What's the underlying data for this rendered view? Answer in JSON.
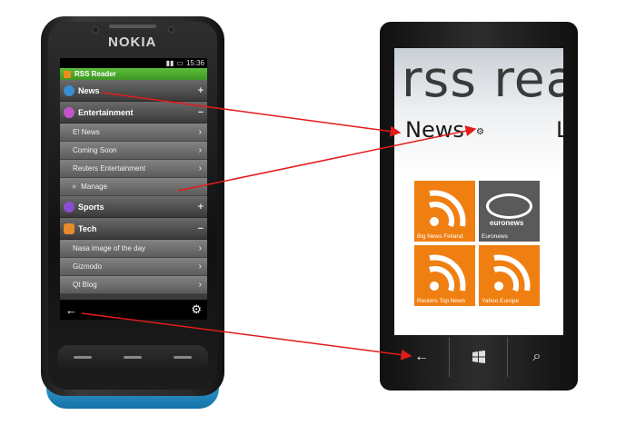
{
  "nokia": {
    "brand": "NOKIA",
    "status_time": "15:36",
    "app_title": "RSS Reader",
    "categories": [
      {
        "label": "News",
        "sign": "+",
        "color": "#3b8fd0"
      },
      {
        "label": "Entertainment",
        "sign": "−",
        "color": "#c455c8",
        "items": [
          "E! News",
          "Coming Soon",
          "Reuters Entertainment"
        ],
        "manage": "Manage"
      },
      {
        "label": "Sports",
        "sign": "+",
        "color": "#8a4fd0"
      },
      {
        "label": "Tech",
        "sign": "−",
        "color": "#e88a2b",
        "items": [
          "Nasa image of the day",
          "Gizmodo",
          "Qt Blog"
        ]
      }
    ]
  },
  "wp": {
    "heading": "rss rea",
    "pivot": "News",
    "pivot_next": "L",
    "tiles": [
      {
        "label": "Big News Finland",
        "color": "#f07f12",
        "icon": "rss-icon"
      },
      {
        "label": "Euronews",
        "color": "#5a5a5a",
        "icon": "euronews-logo",
        "logo_text": "euronews"
      },
      {
        "label": "Reuters Top News",
        "color": "#f07f12",
        "icon": "rss-icon"
      },
      {
        "label": "Yahoo Europe",
        "color": "#f07f12",
        "icon": "rss-icon"
      }
    ]
  },
  "colors": {
    "arrow": "#e21b1b",
    "tile_orange": "#f07f12"
  }
}
